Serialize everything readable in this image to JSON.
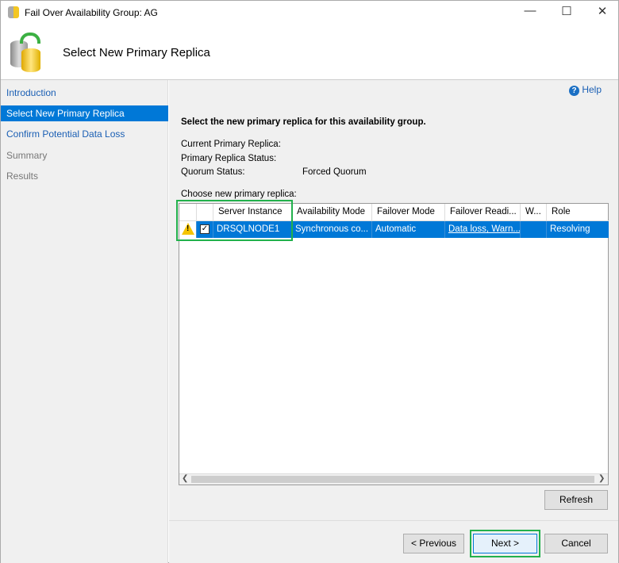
{
  "window": {
    "title": "Fail Over Availability Group: AG"
  },
  "header": {
    "title": "Select New Primary Replica"
  },
  "nav": {
    "items": [
      {
        "label": "Introduction",
        "state": "link"
      },
      {
        "label": "Select New Primary Replica",
        "state": "selected"
      },
      {
        "label": "Confirm Potential Data Loss",
        "state": "link"
      },
      {
        "label": "Summary",
        "state": "disabled"
      },
      {
        "label": "Results",
        "state": "disabled"
      }
    ]
  },
  "main": {
    "help": "Help",
    "instruction": "Select the new primary replica for this availability group.",
    "current_primary_label": "Current Primary Replica:",
    "primary_status_label": "Primary Replica Status:",
    "quorum_label": "Quorum Status:",
    "quorum_value": "Forced Quorum",
    "choose_label": "Choose new primary replica:",
    "columns": [
      "",
      "",
      "Server Instance",
      "Availability Mode",
      "Failover Mode",
      "Failover Readi...",
      "W...",
      "Role"
    ],
    "rows": [
      {
        "checked": true,
        "server": "DRSQLNODE1",
        "availability_mode": "Synchronous co...",
        "failover_mode": "Automatic",
        "readiness": "Data loss, Warn...",
        "w": "",
        "role": "Resolving"
      }
    ],
    "refresh": "Refresh"
  },
  "footer": {
    "previous": "< Previous",
    "next": "Next >",
    "cancel": "Cancel"
  }
}
